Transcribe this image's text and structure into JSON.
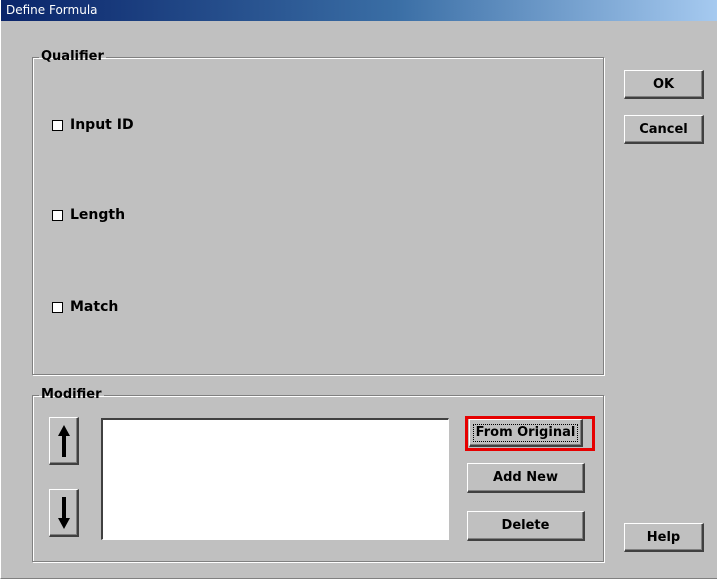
{
  "window": {
    "title": "Define Formula"
  },
  "qualifier": {
    "legend": "Qualifier",
    "options": [
      {
        "label": "Input ID",
        "checked": false
      },
      {
        "label": "Length",
        "checked": false
      },
      {
        "label": "Match",
        "checked": false
      }
    ]
  },
  "modifier": {
    "legend": "Modifier",
    "items": [],
    "buttons": {
      "from_original": "From Original",
      "add_new": "Add New",
      "delete": "Delete"
    },
    "icons": {
      "up": "arrow-up-icon",
      "down": "arrow-down-icon"
    }
  },
  "buttons": {
    "ok": "OK",
    "cancel": "Cancel",
    "help": "Help"
  },
  "colors": {
    "highlight": "#e60000",
    "face": "#c0c0c0",
    "title_start": "#0a246a",
    "title_end": "#a6caf0"
  }
}
